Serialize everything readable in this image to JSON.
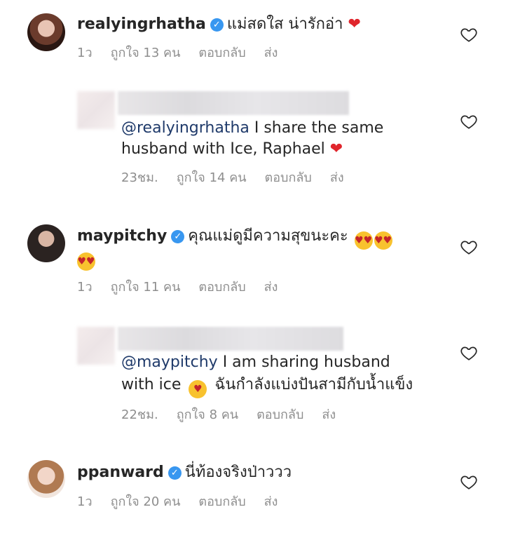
{
  "comments": [
    {
      "username": "realyingrhatha",
      "text": "แม่สดใส น่ารักอ่า",
      "trail_emoji": "heart",
      "time": "1ว",
      "likes": "ถูกใจ 13 คน",
      "reply": "ตอบกลับ",
      "send": "ส่ง"
    },
    {
      "mention": "@realyingrhatha",
      "text_line1": " I share the same",
      "text_line2": "husband with Ice, Raphael",
      "trail_emoji": "heart",
      "time": "23ชม.",
      "likes": "ถูกใจ 14 คน",
      "reply": "ตอบกลับ",
      "send": "ส่ง"
    },
    {
      "username": "maypitchy",
      "text": "คุณแม่ดูมีความสุขนะคะ",
      "trail_emoji": "heart-eyes",
      "time": "1ว",
      "likes": "ถูกใจ 11 คน",
      "reply": "ตอบกลับ",
      "send": "ส่ง"
    },
    {
      "mention": "@maypitchy",
      "text_line1": " I am sharing husband",
      "text_line2_a": "with ice",
      "text_line2_b": "ฉันกำลังแบ่งปันสามีกับน้ำแข็ง",
      "mid_emoji": "kissing-face",
      "time": "22ชม.",
      "likes": "ถูกใจ 8 คน",
      "reply": "ตอบกลับ",
      "send": "ส่ง"
    },
    {
      "username": "ppanward",
      "text": "นี่ท้องจริงป่าววว",
      "time": "1ว",
      "likes": "ถูกใจ 20 คน",
      "reply": "ตอบกลับ",
      "send": "ส่ง"
    }
  ],
  "icons": {
    "verified": "verified-badge-icon",
    "like": "heart-outline-icon"
  },
  "colors": {
    "verified": "#3897f0",
    "meta": "#8e8e8e",
    "mention": "#1f3a6a",
    "heart": "#e0252c"
  }
}
